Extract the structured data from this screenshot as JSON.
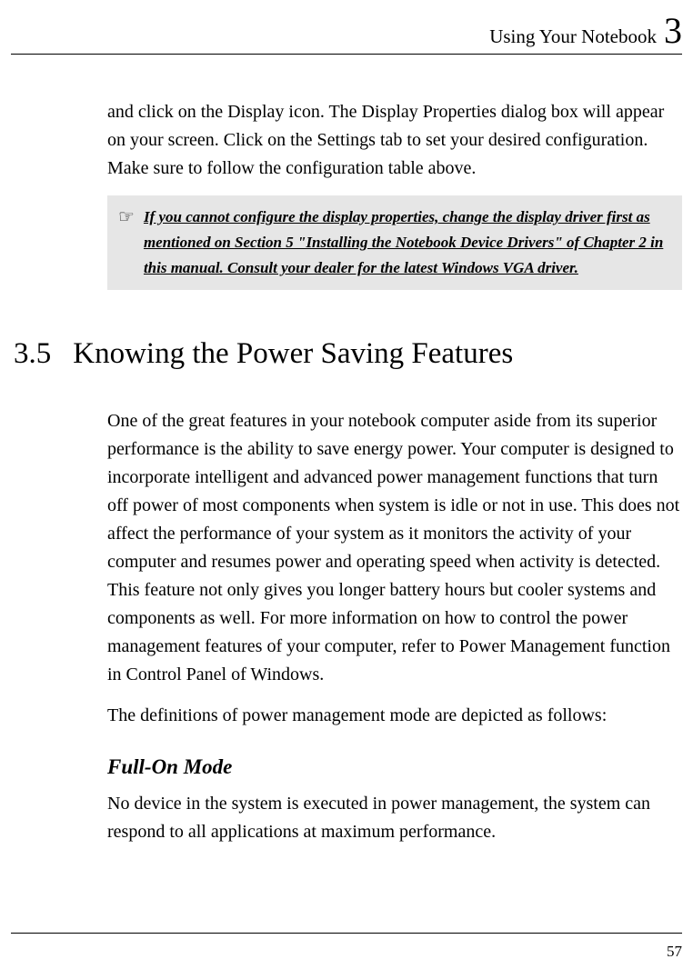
{
  "header": {
    "title": "Using Your Notebook",
    "chapter_number": "3"
  },
  "intro_paragraph": "and click on the Display icon. The Display Properties dialog box will appear on your screen. Click on the Settings tab to set your desired configuration. Make sure to follow the configuration table above.",
  "note": {
    "icon": "☞",
    "text": "If you cannot configure the display properties, change the display driver first as mentioned on Section 5 \"Installing the Notebook Device Drivers\" of Chapter 2 in this manual. Consult your dealer for the latest Windows VGA driver."
  },
  "section": {
    "number": "3.5",
    "title": "Knowing the Power Saving Features"
  },
  "section_body_1": "One of the great features in your notebook computer aside from its superior performance is the ability to save energy power. Your computer is designed to incorporate intelligent and advanced power management functions that turn off power of most components when system is idle or not in use. This does not affect the performance of your system as it monitors the activity of your computer and resumes power and operating speed when activity is detected. This feature not only gives you longer battery hours but cooler systems and components as well. For more information on how to control the power management features of your computer, refer to Power Management function in Control Panel of Windows.",
  "section_body_2": "The definitions of power management mode are depicted as follows:",
  "subsection": {
    "title": "Full-On Mode",
    "body": "No device in the system is executed in power management, the system can respond to all applications at maximum performance."
  },
  "page_number": "57"
}
